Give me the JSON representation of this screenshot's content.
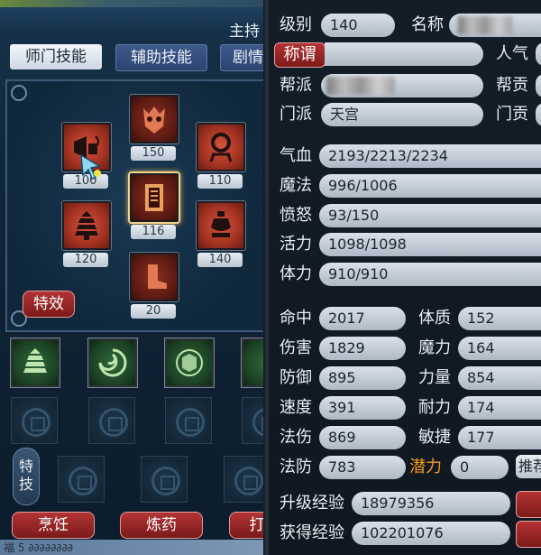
{
  "window": {
    "title_partial": "主持"
  },
  "skill_panel": {
    "tabs": [
      "师门技能",
      "辅助技能",
      "剧情"
    ],
    "main_skills": [
      {
        "icon": "signal-horn-icon",
        "level": "100"
      },
      {
        "icon": "demon-mask-icon",
        "level": "150"
      },
      {
        "icon": "ring-stand-icon",
        "level": "110"
      },
      {
        "icon": "pagoda-icon",
        "level": "120"
      },
      {
        "icon": "scroll-tablet-icon",
        "level": "116"
      },
      {
        "icon": "urn-icon",
        "level": "140"
      },
      {
        "icon": "boot-icon",
        "level": "20"
      }
    ],
    "effects_button": "特效",
    "special_skill_label": "特技",
    "bottom_buttons": [
      "烹饪",
      "炼药",
      "打"
    ],
    "bottom_strip_text": "福 5 ∂∂∂∂∂∂∂∂"
  },
  "attributes": {
    "level_label": "级别",
    "level_value": "140",
    "name_label": "名称",
    "title_button": "称谓",
    "popularity_label": "人气",
    "gang_label": "帮派",
    "gang_contribution_label": "帮贡",
    "sect_label": "门派",
    "sect_value": "天宫",
    "sect_contribution_label": "门贡",
    "hp_label": "气血",
    "hp_value": "2193/2213/2234",
    "mp_label": "魔法",
    "mp_value": "996/1006",
    "anger_label": "愤怒",
    "anger_value": "93/150",
    "vitality_label": "活力",
    "vitality_value": "1098/1098",
    "stamina_label": "体力",
    "stamina_value": "910/910",
    "hit_label": "命中",
    "hit_value": "2017",
    "constitution_label": "体质",
    "constitution_value": "152",
    "damage_label": "伤害",
    "damage_value": "1829",
    "magic_power_label": "魔力",
    "magic_power_value": "164",
    "defense_label": "防御",
    "defense_value": "895",
    "strength_label": "力量",
    "strength_value": "854",
    "speed_label": "速度",
    "speed_value": "391",
    "endurance_label": "耐力",
    "endurance_value": "174",
    "spell_damage_label": "法伤",
    "spell_damage_value": "869",
    "agility_label": "敏捷",
    "agility_value": "177",
    "spell_defense_label": "法防",
    "spell_defense_value": "783",
    "potential_label": "潜力",
    "potential_value": "0",
    "recommend_button": "推荐",
    "upgrade_exp_label": "升级经验",
    "upgrade_exp_value": "18979356",
    "gained_exp_label": "获得经验",
    "gained_exp_value": "102201076"
  },
  "colors": {
    "accent_red": "#b53232",
    "potential_orange": "#f39a1c",
    "field_bg": "#d9e0e8"
  }
}
